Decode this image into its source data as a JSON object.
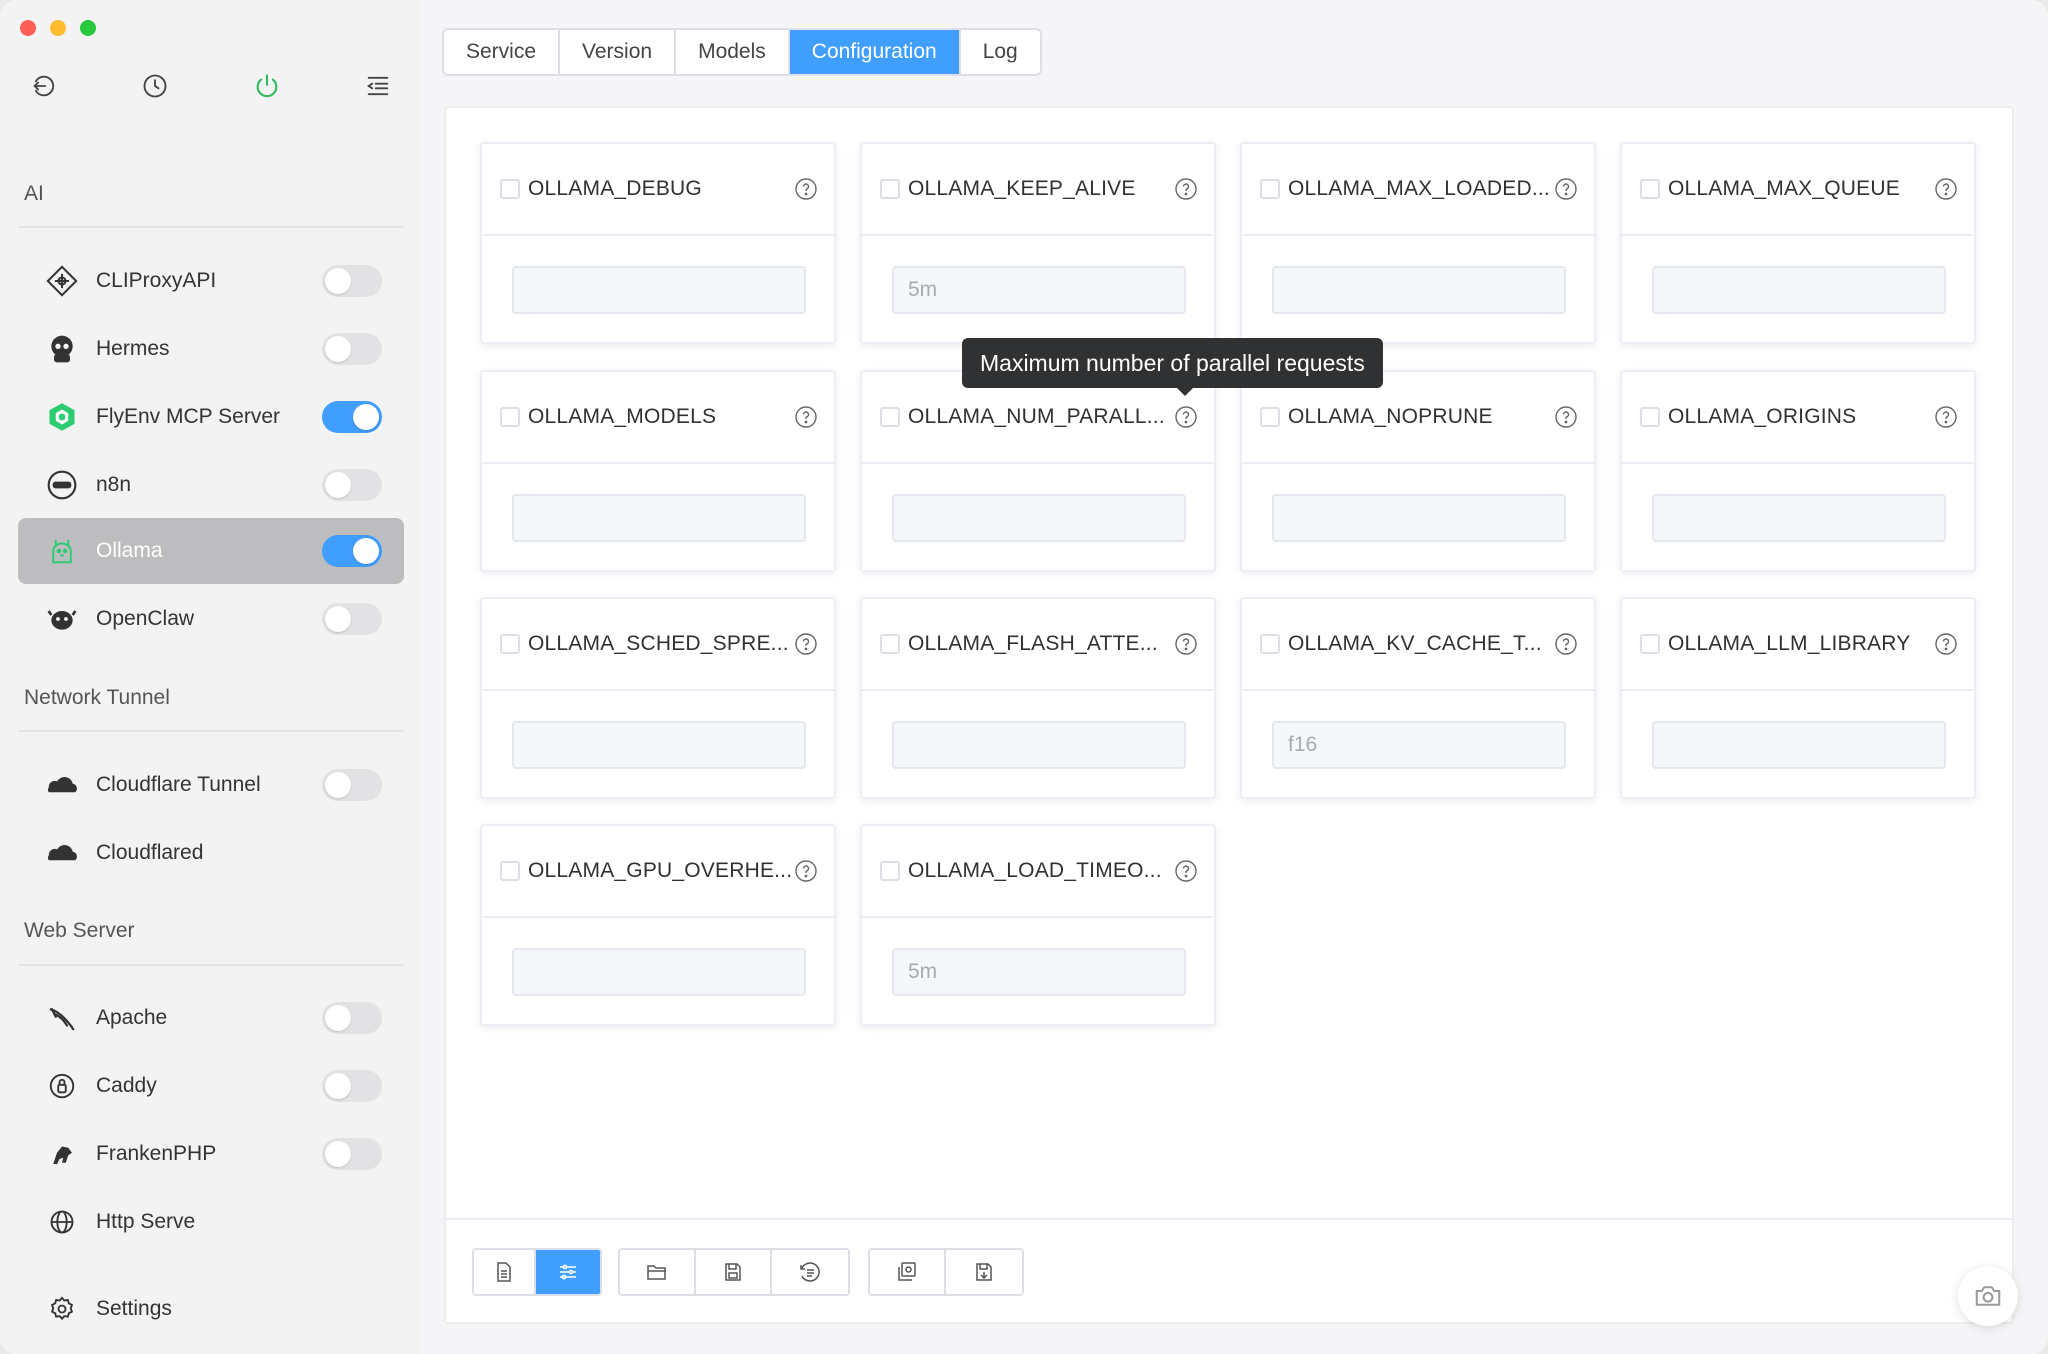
{
  "window": {
    "traffic_lights": [
      "close",
      "minimize",
      "zoom"
    ]
  },
  "sidebar": {
    "toolbar_icons": [
      "back-icon",
      "history-icon",
      "power-icon",
      "collapse-menu-icon"
    ],
    "sections": [
      {
        "title": "AI"
      },
      {
        "title": "Network Tunnel"
      },
      {
        "title": "Web Server"
      }
    ],
    "items": [
      {
        "label": "CLIProxyAPI",
        "icon": "cliproxy-icon",
        "toggle": false
      },
      {
        "label": "Hermes",
        "icon": "hermes-icon",
        "toggle": false
      },
      {
        "label": "FlyEnv MCP Server",
        "icon": "flyenv-mcp-icon",
        "toggle": true
      },
      {
        "label": "n8n",
        "icon": "n8n-icon",
        "toggle": false
      },
      {
        "label": "Ollama",
        "icon": "ollama-icon",
        "toggle": true,
        "active": true
      },
      {
        "label": "OpenClaw",
        "icon": "openclaw-icon",
        "toggle": false
      },
      {
        "label": "Cloudflare Tunnel",
        "icon": "cloudflare-icon",
        "toggle": false
      },
      {
        "label": "Cloudflared",
        "icon": "cloudflared-icon"
      },
      {
        "label": "Apache",
        "icon": "apache-icon",
        "toggle": false
      },
      {
        "label": "Caddy",
        "icon": "caddy-icon",
        "toggle": false
      },
      {
        "label": "FrankenPHP",
        "icon": "frankenphp-icon",
        "toggle": false
      },
      {
        "label": "Http Serve",
        "icon": "globe-icon"
      },
      {
        "label": "Settings",
        "icon": "settings-icon"
      }
    ]
  },
  "tabs": [
    {
      "label": "Service"
    },
    {
      "label": "Version"
    },
    {
      "label": "Models"
    },
    {
      "label": "Configuration",
      "active": true
    },
    {
      "label": "Log"
    }
  ],
  "config_cards": [
    {
      "title": "OLLAMA_DEBUG",
      "value": "",
      "placeholder": ""
    },
    {
      "title": "OLLAMA_KEEP_ALIVE",
      "value": "",
      "placeholder": "5m"
    },
    {
      "title": "OLLAMA_MAX_LOADED...",
      "value": "",
      "placeholder": ""
    },
    {
      "title": "OLLAMA_MAX_QUEUE",
      "value": "",
      "placeholder": ""
    },
    {
      "title": "OLLAMA_MODELS",
      "value": "",
      "placeholder": ""
    },
    {
      "title": "OLLAMA_NUM_PARALL...",
      "value": "",
      "placeholder": ""
    },
    {
      "title": "OLLAMA_NOPRUNE",
      "value": "",
      "placeholder": ""
    },
    {
      "title": "OLLAMA_ORIGINS",
      "value": "",
      "placeholder": ""
    },
    {
      "title": "OLLAMA_SCHED_SPRE...",
      "value": "",
      "placeholder": ""
    },
    {
      "title": "OLLAMA_FLASH_ATTE...",
      "value": "",
      "placeholder": ""
    },
    {
      "title": "OLLAMA_KV_CACHE_T...",
      "value": "",
      "placeholder": "f16"
    },
    {
      "title": "OLLAMA_LLM_LIBRARY",
      "value": "",
      "placeholder": ""
    },
    {
      "title": "OLLAMA_GPU_OVERHE...",
      "value": "",
      "placeholder": ""
    },
    {
      "title": "OLLAMA_LOAD_TIMEO...",
      "value": "",
      "placeholder": "5m"
    }
  ],
  "tooltip": {
    "text": "Maximum number of parallel requests"
  },
  "bottom_toolbar": {
    "group1": [
      {
        "icon": "document-icon",
        "active": false
      },
      {
        "icon": "sliders-icon",
        "active": true
      }
    ],
    "group2": [
      {
        "icon": "folder-open-icon"
      },
      {
        "icon": "save-icon"
      },
      {
        "icon": "history-list-icon"
      }
    ],
    "group3": [
      {
        "icon": "load-config-icon"
      },
      {
        "icon": "save-config-icon"
      }
    ]
  },
  "colors": {
    "accent": "#409eff",
    "sidebar_active": "#bdbdc0",
    "tooltip_bg": "#303133",
    "power_icon": "#2fba5c"
  }
}
